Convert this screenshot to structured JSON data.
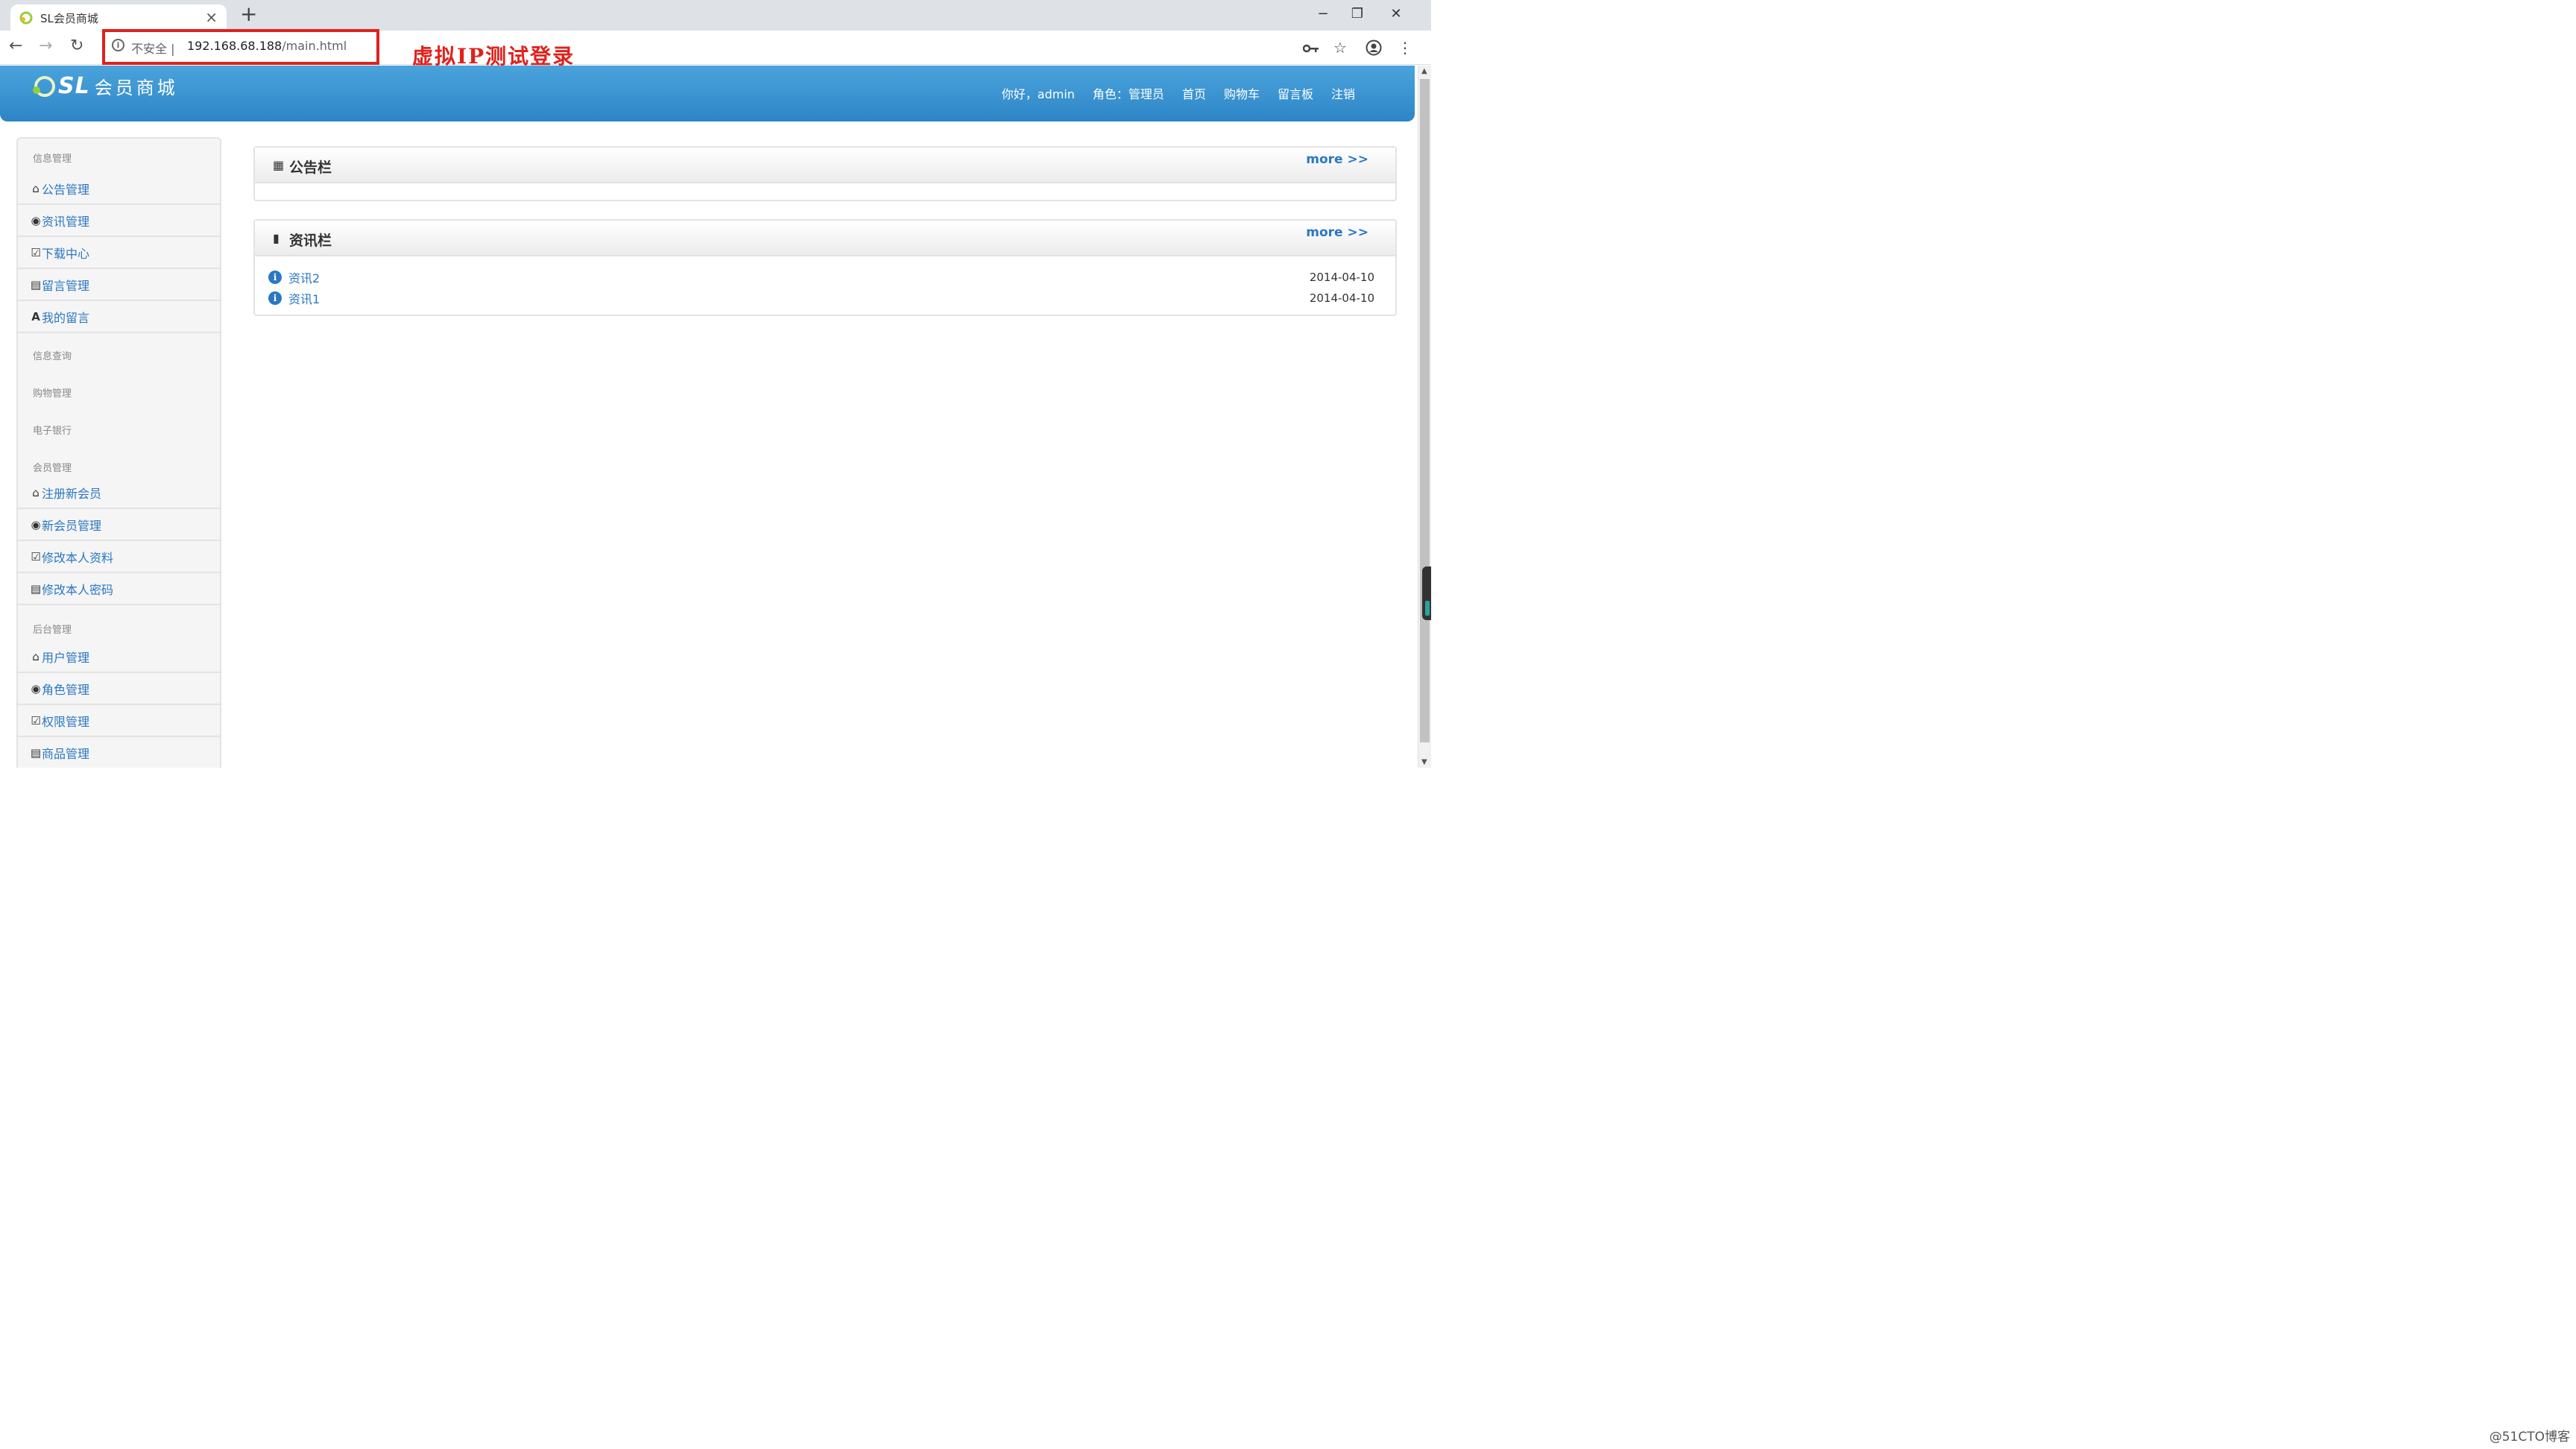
{
  "browser": {
    "tab_title": "SL会员商城",
    "tab_close": "×",
    "new_tab": "+",
    "window_controls": {
      "minimize": "−",
      "restore": "❐",
      "close": "✕"
    },
    "nav": {
      "back": "←",
      "forward": "→",
      "reload": "↻"
    },
    "omnibox": {
      "security_icon": "info-icon",
      "security_label": "不安全 |",
      "url_host": "192.168.68.188",
      "url_path": "/main.html"
    },
    "toolbar_icons": {
      "key": "key-icon",
      "star": "☆",
      "account": "account-icon",
      "menu": "⋮"
    }
  },
  "annotation": "虚拟IP测试登录",
  "header": {
    "logo_sl": "SL",
    "logo_cn": "会员商城",
    "nav": {
      "greeting": "你好，admin",
      "role": "角色：管理员",
      "home": "首页",
      "cart": "购物车",
      "guestbook": "留言板",
      "logout": "注销"
    }
  },
  "sidebar": {
    "info_mgmt": {
      "title": "信息管理",
      "items": [
        "公告管理",
        "资讯管理",
        "下载中心",
        "留言管理",
        "我的留言"
      ]
    },
    "info_query": {
      "title": "信息查询"
    },
    "shopping_mgmt": {
      "title": "购物管理"
    },
    "ebank": {
      "title": "电子银行"
    },
    "member_mgmt": {
      "title": "会员管理",
      "items": [
        "注册新会员",
        "新会员管理",
        "修改本人资料",
        "修改本人密码"
      ]
    },
    "admin_mgmt": {
      "title": "后台管理",
      "items": [
        "用户管理",
        "角色管理",
        "权限管理",
        "商品管理"
      ]
    }
  },
  "notice_panel": {
    "title": "公告栏",
    "more": "more >>"
  },
  "news_panel": {
    "title": "资讯栏",
    "more": "more >>",
    "items": [
      {
        "title": "资讯2",
        "date": "2014-04-10"
      },
      {
        "title": "资讯1",
        "date": "2014-04-10"
      }
    ]
  },
  "watermark": "@51CTO博客"
}
